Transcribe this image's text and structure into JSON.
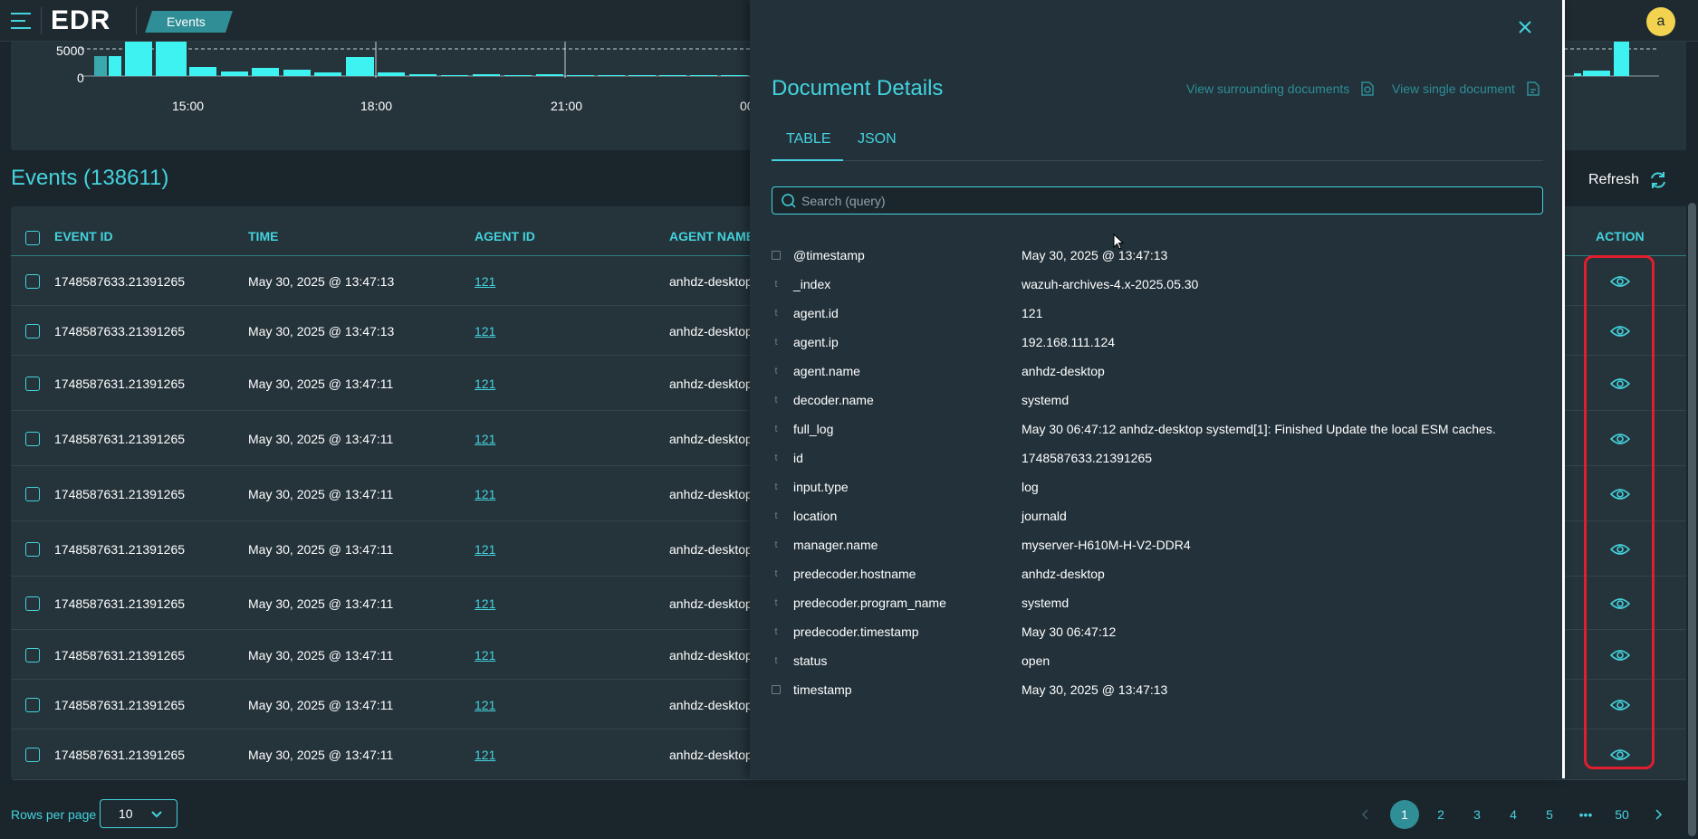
{
  "app": {
    "logo": "EDR",
    "breadcrumb": "Events",
    "avatar_initial": "a"
  },
  "histogram": {
    "y_ticks": [
      "5000",
      "0"
    ],
    "x_ticks": [
      "15:00",
      "18:00",
      "21:00",
      "00"
    ]
  },
  "events": {
    "title": "Events (138611)",
    "refresh_label": "Refresh",
    "columns": [
      "EVENT ID",
      "TIME",
      "AGENT ID",
      "AGENT NAME",
      "ACTION"
    ],
    "rows": [
      {
        "event_id": "1748587633.21391265",
        "time": "May 30, 2025 @ 13:47:13",
        "agent_id": "121",
        "agent_name": "anhdz-desktop"
      },
      {
        "event_id": "1748587633.21391265",
        "time": "May 30, 2025 @ 13:47:13",
        "agent_id": "121",
        "agent_name": "anhdz-desktop"
      },
      {
        "event_id": "1748587631.21391265",
        "time": "May 30, 2025 @ 13:47:11",
        "agent_id": "121",
        "agent_name": "anhdz-desktop"
      },
      {
        "event_id": "1748587631.21391265",
        "time": "May 30, 2025 @ 13:47:11",
        "agent_id": "121",
        "agent_name": "anhdz-desktop"
      },
      {
        "event_id": "1748587631.21391265",
        "time": "May 30, 2025 @ 13:47:11",
        "agent_id": "121",
        "agent_name": "anhdz-desktop"
      },
      {
        "event_id": "1748587631.21391265",
        "time": "May 30, 2025 @ 13:47:11",
        "agent_id": "121",
        "agent_name": "anhdz-desktop"
      },
      {
        "event_id": "1748587631.21391265",
        "time": "May 30, 2025 @ 13:47:11",
        "agent_id": "121",
        "agent_name": "anhdz-desktop"
      },
      {
        "event_id": "1748587631.21391265",
        "time": "May 30, 2025 @ 13:47:11",
        "agent_id": "121",
        "agent_name": "anhdz-desktop"
      },
      {
        "event_id": "1748587631.21391265",
        "time": "May 30, 2025 @ 13:47:11",
        "agent_id": "121",
        "agent_name": "anhdz-desktop"
      },
      {
        "event_id": "1748587631.21391265",
        "time": "May 30, 2025 @ 13:47:11",
        "agent_id": "121",
        "agent_name": "anhdz-desktop"
      }
    ]
  },
  "footer": {
    "rows_per_page_label": "Rows per page",
    "rows_per_page_value": "10",
    "pages": [
      "1",
      "2",
      "3",
      "4",
      "5",
      "•••",
      "50"
    ],
    "active_page": "1"
  },
  "flyout": {
    "title": "Document Details",
    "view_surrounding": "View surrounding documents",
    "view_single": "View single document",
    "tabs": [
      "TABLE",
      "JSON"
    ],
    "active_tab": "TABLE",
    "search_placeholder": "Search (query)",
    "fields": [
      {
        "type": "date",
        "name": "@timestamp",
        "value": "May 30, 2025 @ 13:47:13"
      },
      {
        "type": "t",
        "name": "_index",
        "value": "wazuh-archives-4.x-2025.05.30"
      },
      {
        "type": "t",
        "name": "agent.id",
        "value": "121"
      },
      {
        "type": "t",
        "name": "agent.ip",
        "value": "192.168.111.124"
      },
      {
        "type": "t",
        "name": "agent.name",
        "value": "anhdz-desktop"
      },
      {
        "type": "t",
        "name": "decoder.name",
        "value": "systemd"
      },
      {
        "type": "t",
        "name": "full_log",
        "value": "May 30 06:47:12 anhdz-desktop systemd[1]: Finished Update the local ESM caches."
      },
      {
        "type": "t",
        "name": "id",
        "value": "1748587633.21391265"
      },
      {
        "type": "t",
        "name": "input.type",
        "value": "log"
      },
      {
        "type": "t",
        "name": "location",
        "value": "journald"
      },
      {
        "type": "t",
        "name": "manager.name",
        "value": "myserver-H610M-H-V2-DDR4"
      },
      {
        "type": "t",
        "name": "predecoder.hostname",
        "value": "anhdz-desktop"
      },
      {
        "type": "t",
        "name": "predecoder.program_name",
        "value": "systemd"
      },
      {
        "type": "t",
        "name": "predecoder.timestamp",
        "value": "May 30 06:47:12"
      },
      {
        "type": "t",
        "name": "status",
        "value": "open"
      },
      {
        "type": "date",
        "name": "timestamp",
        "value": "May 30, 2025 @ 13:47:13"
      }
    ]
  },
  "colors": {
    "accent": "#44d3de",
    "background": "#1b262c",
    "panel": "#25333a",
    "highlight": "#e01e2e"
  }
}
